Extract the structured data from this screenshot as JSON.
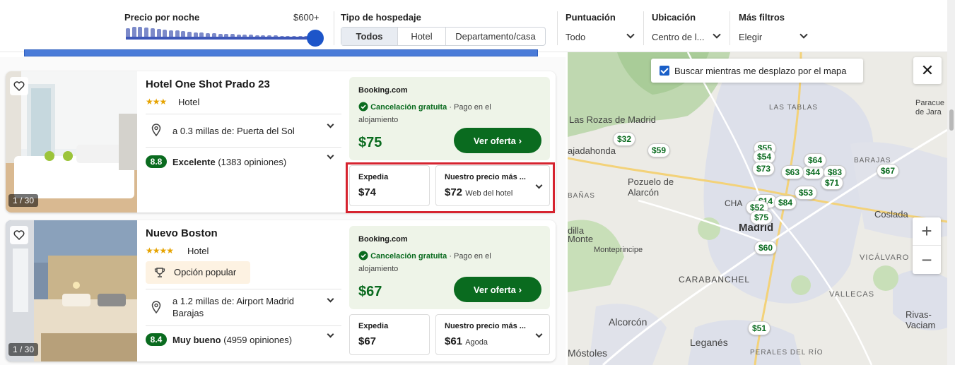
{
  "filters": {
    "price": {
      "label": "Precio por noche",
      "max": "$600+"
    },
    "lodging_type": {
      "label": "Tipo de hospedaje",
      "options": [
        "Todos",
        "Hotel",
        "Departamento/casa"
      ],
      "selected": "Todos"
    },
    "rating": {
      "label": "Puntuación",
      "value": "Todo"
    },
    "location": {
      "label": "Ubicación",
      "value": "Centro de l..."
    },
    "more": {
      "label": "Más filtros",
      "value": "Elegir"
    }
  },
  "results": [
    {
      "name": "Hotel One Shot Prado 23",
      "stars": 3,
      "stars_text": "★★★",
      "type": "Hotel",
      "distance": "a 0.3 millas de: Puerta del Sol",
      "score": "8.8",
      "rating_word": "Excelente",
      "reviews": "(1383 opiniones)",
      "image_counter": "1 / 30",
      "offer": {
        "provider": "Booking.com",
        "free_cancel": "Cancelación gratuita",
        "pay_note": "· Pago en el alojamiento",
        "price": "$75",
        "cta": "Ver oferta"
      },
      "alt1": {
        "provider": "Expedia",
        "price": "$74"
      },
      "alt2": {
        "provider": "Nuestro precio más ...",
        "price": "$72",
        "source": "Web del hotel"
      }
    },
    {
      "name": "Nuevo Boston",
      "stars": 4,
      "stars_text": "★★★★",
      "type": "Hotel",
      "badge": "Opción popular",
      "distance": "a 1.2 millas de: Airport Madrid Barajas",
      "score": "8.4",
      "rating_word": "Muy bueno",
      "reviews": "(4959 opiniones)",
      "image_counter": "1 / 30",
      "offer": {
        "provider": "Booking.com",
        "free_cancel": "Cancelación gratuita",
        "pay_note": "· Pago en el alojamiento",
        "price": "$67",
        "cta": "Ver oferta"
      },
      "alt1": {
        "provider": "Expedia",
        "price": "$67"
      },
      "alt2": {
        "provider": "Nuestro precio más ...",
        "price": "$61",
        "source": "Agoda"
      }
    }
  ],
  "map": {
    "search_while_moving": "Buscar mientras me desplazo por el mapa",
    "zoom_in": "+",
    "zoom_out": "−",
    "close": "✕",
    "places": {
      "las_rozas": "Las Rozas de Madrid",
      "majadahonda": "ajadahonda",
      "pozuelo": "Pozuelo de Alarcón",
      "villa_1": "dilla",
      "villa_2": "Monte",
      "monteprincipe": "Monteprincipe",
      "carabanchel": "CARABANCHEL",
      "alcorcon": "Alcorcón",
      "leganes": "Leganés",
      "mostoles": "Móstoles",
      "madrid": "Madrid",
      "coslada": "Coslada",
      "vicalvaro": "VICÁLVARO",
      "vallecas": "VALLECAS",
      "rivas": "Rivas-Vaciam",
      "las_tablas": "LAS TABLAS",
      "barajas": "BARAJAS",
      "paracuellos": "Paracue de Jara",
      "perales": "PERALES DEL RÍO",
      "banas": "BAÑAS",
      "cha": "CHA"
    },
    "pins": [
      "$32",
      "$59",
      "$55",
      "$54",
      "$73",
      "$63",
      "$44",
      "$64",
      "$83",
      "$67",
      "$71",
      "$53",
      "$14",
      "$52",
      "$84",
      "$75",
      "$60",
      "$51"
    ]
  }
}
